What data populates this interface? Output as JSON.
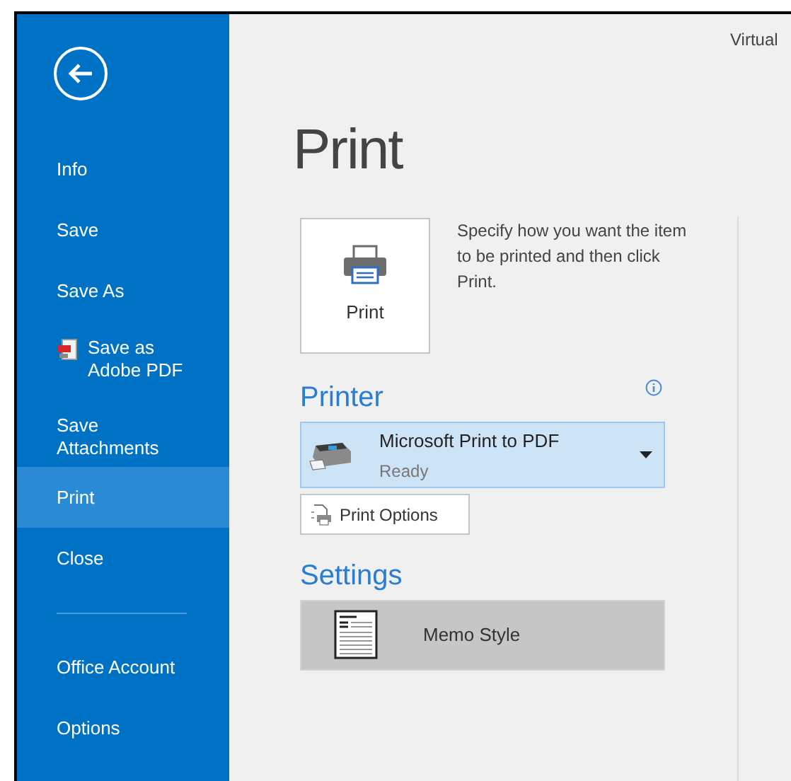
{
  "sidebar": {
    "items": [
      {
        "label": "Info",
        "kind": "item",
        "selected": false
      },
      {
        "label": "Save",
        "kind": "item",
        "selected": false
      },
      {
        "label": "Save As",
        "kind": "item",
        "selected": false
      },
      {
        "label": "Save as Adobe PDF",
        "kind": "pdf",
        "selected": false
      },
      {
        "label": "Save Attachments",
        "kind": "item",
        "selected": false
      },
      {
        "label": "Print",
        "kind": "item",
        "selected": true
      },
      {
        "label": "Close",
        "kind": "item",
        "selected": false
      },
      {
        "kind": "separator"
      },
      {
        "label": "Office Account",
        "kind": "item",
        "selected": false
      },
      {
        "label": "Options",
        "kind": "item",
        "selected": false
      }
    ]
  },
  "header_text": "Virtual",
  "title": "Print",
  "print_button": {
    "label": "Print"
  },
  "description": "Specify how you want the item to be printed and then click Print.",
  "printer": {
    "heading": "Printer",
    "name": "Microsoft Print to PDF",
    "status": "Ready",
    "options_button": "Print Options"
  },
  "settings": {
    "heading": "Settings",
    "style": "Memo Style"
  }
}
